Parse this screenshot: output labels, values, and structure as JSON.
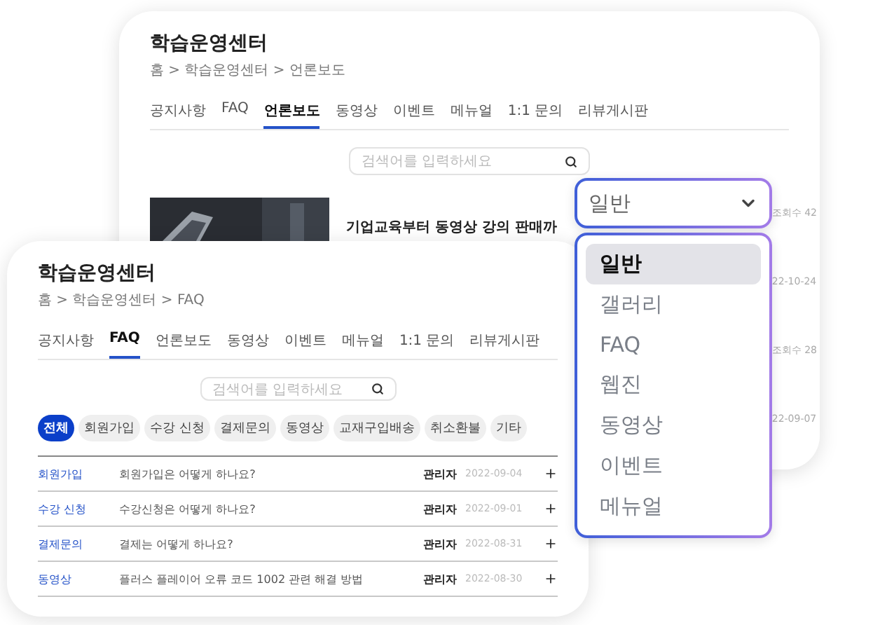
{
  "back_page": {
    "title": "학습운영센터",
    "breadcrumb": "홈 > 학습운영센터 > 언론보도",
    "tabs": [
      {
        "label": "공지사항",
        "selected": false
      },
      {
        "label": "FAQ",
        "selected": false
      },
      {
        "label": "언론보도",
        "selected": true
      },
      {
        "label": "동영상",
        "selected": false
      },
      {
        "label": "이벤트",
        "selected": false
      },
      {
        "label": "메뉴얼",
        "selected": false
      },
      {
        "label": "1:1 문의",
        "selected": false
      },
      {
        "label": "리뷰게시판",
        "selected": false
      }
    ],
    "search": {
      "placeholder": "검색어를 입력하세요"
    },
    "article": {
      "title": "기업교육부터 동영상 강의 판매까"
    },
    "meta": [
      "조회수 42",
      "22-10-24",
      "조회수 28",
      "22-09-07"
    ]
  },
  "front_page": {
    "title": "학습운영센터",
    "breadcrumb": "홈 > 학습운영센터 > FAQ",
    "tabs": [
      {
        "label": "공지사항",
        "selected": false
      },
      {
        "label": "FAQ",
        "selected": true
      },
      {
        "label": "언론보도",
        "selected": false
      },
      {
        "label": "동영상",
        "selected": false
      },
      {
        "label": "이벤트",
        "selected": false
      },
      {
        "label": "메뉴얼",
        "selected": false
      },
      {
        "label": "1:1 문의",
        "selected": false
      },
      {
        "label": "리뷰게시판",
        "selected": false
      }
    ],
    "search": {
      "placeholder": "검색어를 입력하세요"
    },
    "filters": [
      {
        "label": "전체",
        "selected": true
      },
      {
        "label": "회원가입",
        "selected": false
      },
      {
        "label": "수강 신청",
        "selected": false
      },
      {
        "label": "결제문의",
        "selected": false
      },
      {
        "label": "동영상",
        "selected": false
      },
      {
        "label": "교재구입배송",
        "selected": false
      },
      {
        "label": "취소환불",
        "selected": false
      },
      {
        "label": "기타",
        "selected": false
      }
    ],
    "rows": [
      {
        "category": "회원가입",
        "question": "회원가입은 어떻게 하나요?",
        "author": "관리자",
        "date": "2022-09-04"
      },
      {
        "category": "수강 신청",
        "question": "수강신청은 어떻게 하나요?",
        "author": "관리자",
        "date": "2022-09-01"
      },
      {
        "category": "결제문의",
        "question": "결제는 어떻게 하나요?",
        "author": "관리자",
        "date": "2022-08-31"
      },
      {
        "category": "동영상",
        "question": "플러스 플레이어 오류 코드 1002 관련 해결 방법",
        "author": "관리자",
        "date": "2022-08-30"
      }
    ]
  },
  "dropdown": {
    "value": "일반",
    "options": [
      {
        "label": "일반",
        "selected": true
      },
      {
        "label": "갤러리",
        "selected": false
      },
      {
        "label": "FAQ",
        "selected": false
      },
      {
        "label": "웹진",
        "selected": false
      },
      {
        "label": "동영상",
        "selected": false
      },
      {
        "label": "이벤트",
        "selected": false
      },
      {
        "label": "메뉴얼",
        "selected": false
      }
    ]
  }
}
